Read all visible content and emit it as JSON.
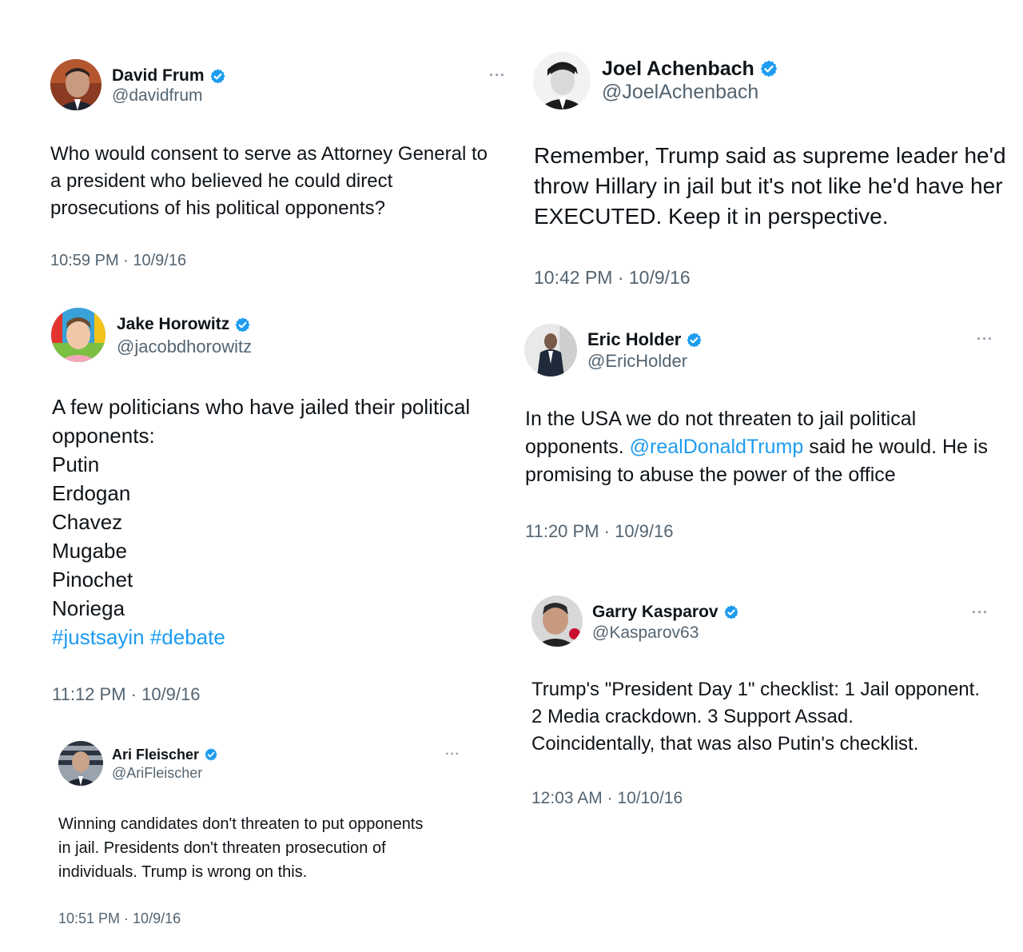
{
  "colors": {
    "verified": "#1d9bf0",
    "link": "#1d9bf0",
    "handle": "#536471"
  },
  "tweets": {
    "frum": {
      "name": "David Frum",
      "handle": "@davidfrum",
      "lines": [
        "Who would consent to serve as Attorney General to",
        "a president who believed he could direct",
        "prosecutions of his political opponents?"
      ],
      "timestamp": "10:59 PM · 10/9/16",
      "more": "···"
    },
    "achenbach": {
      "name": "Joel Achenbach",
      "handle": "@JoelAchenbach",
      "lines": [
        "Remember, Trump said as supreme leader he'd",
        "throw Hillary in jail but it's not like he'd have her",
        "EXECUTED. Keep it in perspective."
      ],
      "timestamp": "10:42 PM · 10/9/16"
    },
    "horowitz": {
      "name": "Jake Horowitz",
      "handle": "@jacobdhorowitz",
      "lines": [
        "A few politicians who have jailed their political",
        "opponents:",
        "Putin",
        "Erdogan",
        "Chavez",
        "Mugabe",
        "Pinochet",
        "Noriega"
      ],
      "hashtags": "#justsayin #debate",
      "timestamp": "11:12 PM · 10/9/16"
    },
    "holder": {
      "name": "Eric Holder",
      "handle": "@EricHolder",
      "line1": "In the USA we do not threaten to jail political",
      "line2_pre": "opponents. ",
      "mention": "@realDonaldTrump",
      "line2_post": " said he would. He is",
      "line3": "promising to abuse the power of the office",
      "timestamp": "11:20 PM · 10/9/16",
      "more": "···"
    },
    "kasparov": {
      "name": "Garry Kasparov",
      "handle": "@Kasparov63",
      "lines": [
        "Trump's \"President Day 1\" checklist: 1 Jail opponent.",
        "2 Media crackdown. 3 Support Assad.",
        "Coincidentally, that was also Putin's checklist."
      ],
      "timestamp": "12:03 AM · 10/10/16",
      "more": "···"
    },
    "fleischer": {
      "name": "Ari Fleischer",
      "handle": "@AriFleischer",
      "lines": [
        "Winning candidates don't threaten to put opponents",
        "in jail. Presidents don't threaten prosecution of",
        "individuals. Trump is wrong on this."
      ],
      "timestamp": "10:51 PM · 10/9/16",
      "more": "···"
    }
  }
}
